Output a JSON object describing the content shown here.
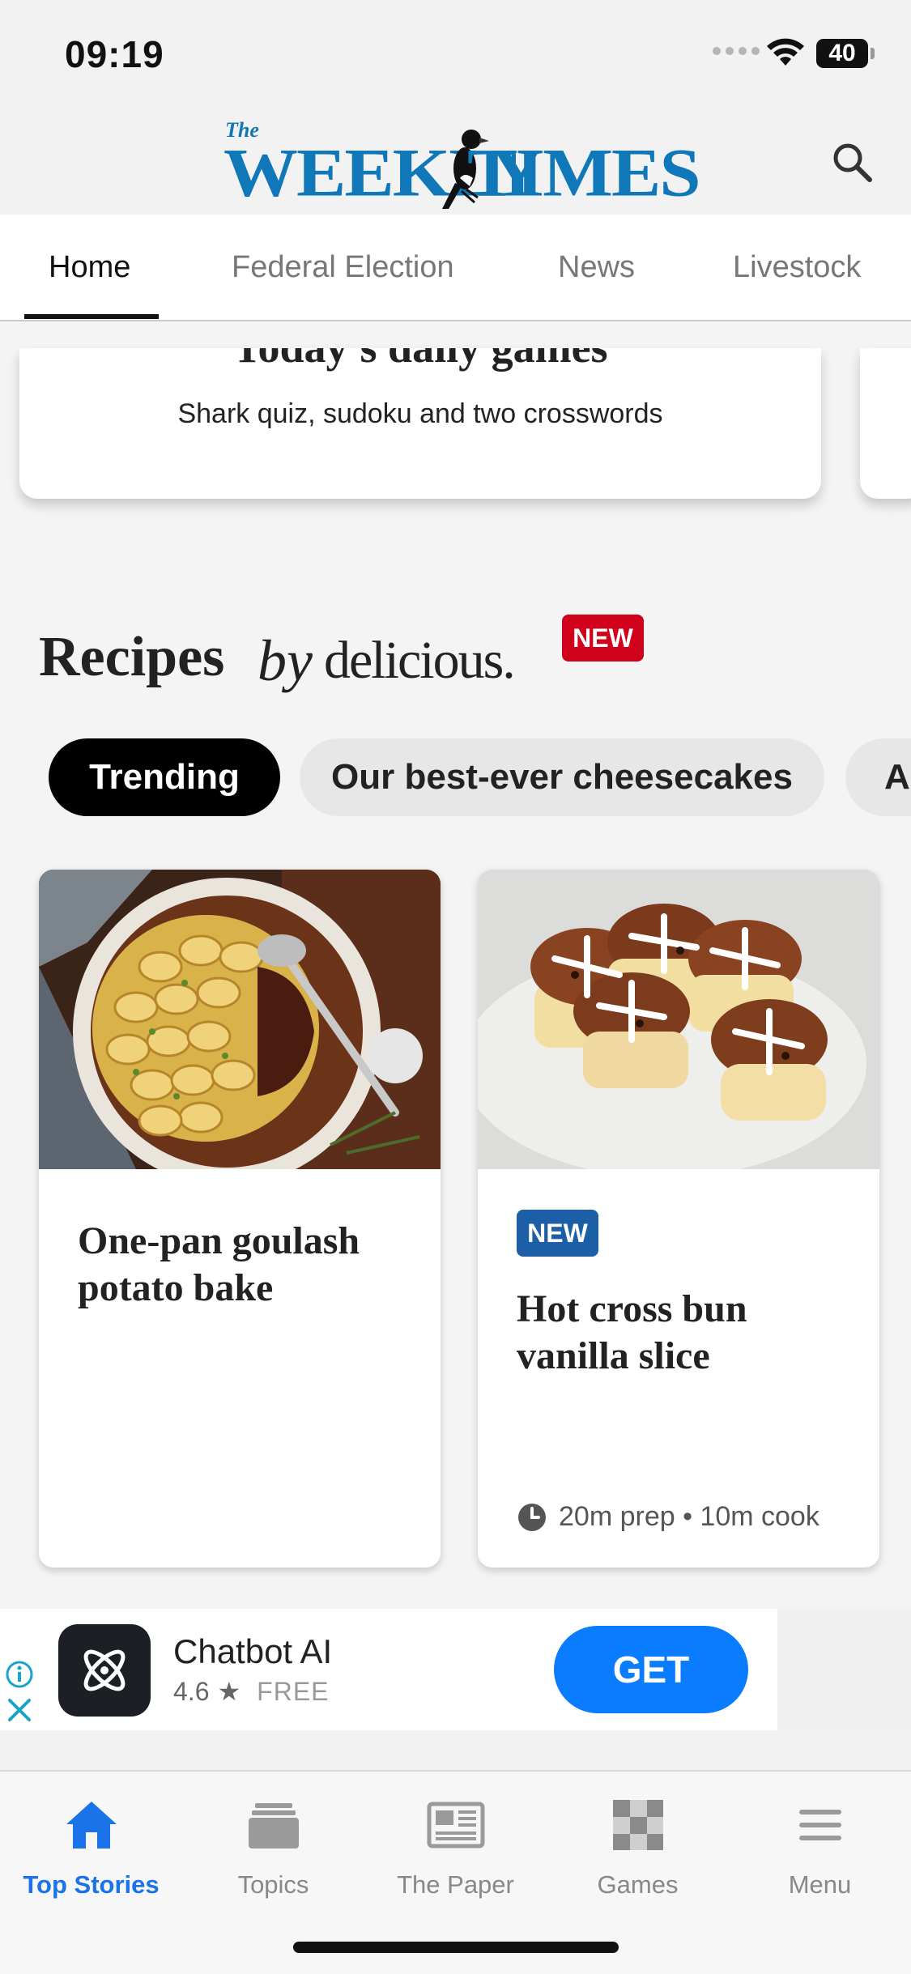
{
  "status_bar": {
    "time": "09:19",
    "battery": "40"
  },
  "header": {
    "logo_the": "The",
    "logo_word1": "WEEKLY",
    "logo_word2": "TIMES"
  },
  "tabs": [
    {
      "label": "Home",
      "active": true
    },
    {
      "label": "Federal Election",
      "active": false
    },
    {
      "label": "News",
      "active": false
    },
    {
      "label": "Livestock",
      "active": false
    }
  ],
  "games_card": {
    "title": "Today's daily games",
    "subtitle": "Shark quiz, sudoku and two crosswords"
  },
  "recipes": {
    "title": "Recipes",
    "by": "by",
    "brand": "delicious.",
    "badge": "NEW",
    "chips": [
      {
        "label": "Trending",
        "active": true
      },
      {
        "label": "Our best-ever cheesecakes",
        "active": false
      },
      {
        "label": "Au",
        "active": false
      }
    ],
    "cards": [
      {
        "name_line1": "One-pan goulash",
        "name_line2": "potato bake",
        "badge": "",
        "meta": ""
      },
      {
        "name_line1": "Hot cross bun",
        "name_line2": "vanilla slice",
        "badge": "NEW",
        "meta": "20m prep • 10m cook"
      }
    ]
  },
  "ad": {
    "app_name": "Chatbot AI",
    "rating": "4.6",
    "price": "FREE",
    "cta": "GET"
  },
  "bottom_nav": [
    {
      "label": "Top Stories",
      "icon": "home-icon",
      "active": true
    },
    {
      "label": "Topics",
      "icon": "topics-icon",
      "active": false
    },
    {
      "label": "The Paper",
      "icon": "newspaper-icon",
      "active": false
    },
    {
      "label": "Games",
      "icon": "checkerboard-icon",
      "active": false
    },
    {
      "label": "Menu",
      "icon": "hamburger-menu-icon",
      "active": false
    }
  ],
  "colors": {
    "brand_blue": "#1078b8",
    "badge_red": "#d0021b",
    "badge_blue": "#1d5fa6",
    "cta_blue": "#0a7cff",
    "active_nav": "#1a73e8"
  }
}
